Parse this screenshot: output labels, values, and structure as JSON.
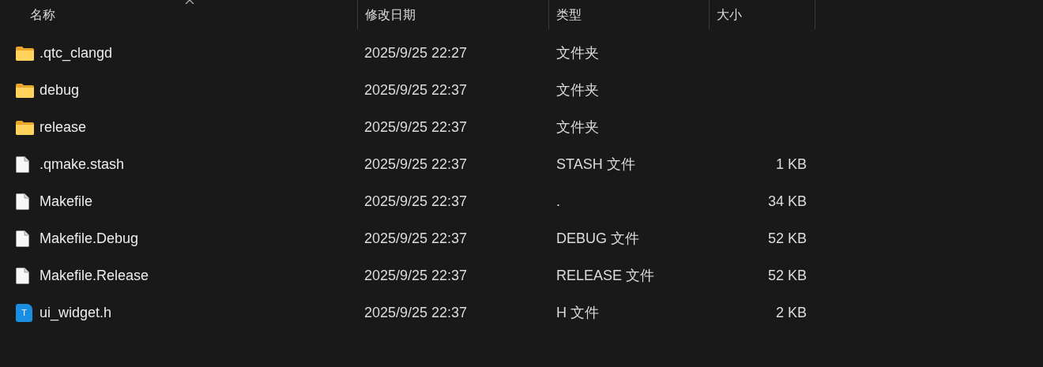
{
  "columns": [
    {
      "label": "名称",
      "sorted": true
    },
    {
      "label": "修改日期",
      "sorted": false
    },
    {
      "label": "类型",
      "sorted": false
    },
    {
      "label": "大小",
      "sorted": false
    }
  ],
  "rows": [
    {
      "kind": "folder",
      "name": ".qtc_clangd",
      "modified": "2025/9/25 22:27",
      "type": "文件夹"
    },
    {
      "kind": "folder",
      "name": "debug",
      "modified": "2025/9/25 22:37",
      "type": "文件夹"
    },
    {
      "kind": "folder",
      "name": "release",
      "modified": "2025/9/25 22:37",
      "type": "文件夹"
    },
    {
      "kind": "file",
      "name": ".qmake.stash",
      "modified": "2025/9/25 22:37",
      "type": "STASH 文件",
      "size": "1 KB"
    },
    {
      "kind": "file",
      "name": "Makefile",
      "modified": "2025/9/25 22:37",
      "type": ".",
      "size": "34 KB"
    },
    {
      "kind": "file",
      "name": "Makefile.Debug",
      "modified": "2025/9/25 22:37",
      "type": "DEBUG 文件",
      "size": "52 KB"
    },
    {
      "kind": "file",
      "name": "Makefile.Release",
      "modified": "2025/9/25 22:37",
      "type": "RELEASE 文件",
      "size": "52 KB"
    },
    {
      "kind": "header",
      "name": "ui_widget.h",
      "modified": "2025/9/25 22:37",
      "type": "H 文件",
      "size": "2 KB",
      "icon_text": "T"
    }
  ]
}
